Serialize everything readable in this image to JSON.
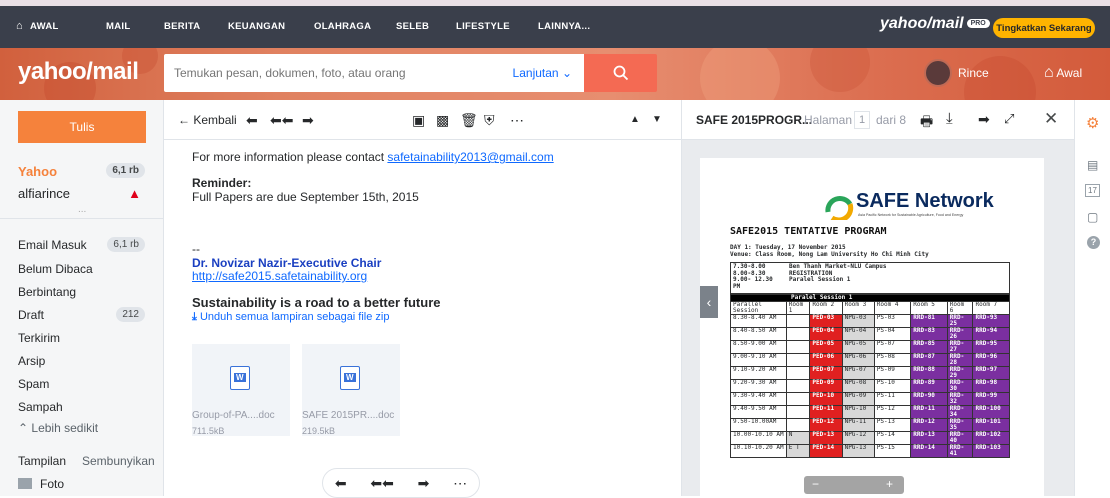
{
  "topnav": {
    "items": [
      "AWAL",
      "MAIL",
      "BERITA",
      "KEUANGAN",
      "OLAHRAGA",
      "SELEB",
      "LIFESTYLE",
      "LAINNYA..."
    ],
    "brand": "yahoo/mail",
    "pro": "PRO",
    "upgrade": "Tingkatkan Sekarang"
  },
  "header": {
    "logo": "yahoo/mail",
    "search_placeholder": "Temukan pesan, dokumen, foto, atau orang",
    "advanced": "Lanjutan",
    "user": "Rince",
    "home": "Awal"
  },
  "sidebar": {
    "compose": "Tulis",
    "account1": "Yahoo",
    "account1_count": "6,1 rb",
    "account2": "alfiarince",
    "more_dots": "...",
    "folders": [
      {
        "label": "Email Masuk",
        "count": "6,1 rb"
      },
      {
        "label": "Belum Dibaca",
        "count": ""
      },
      {
        "label": "Berbintang",
        "count": ""
      },
      {
        "label": "Draft",
        "count": "212"
      },
      {
        "label": "Terkirim",
        "count": ""
      },
      {
        "label": "Arsip",
        "count": ""
      },
      {
        "label": "Spam",
        "count": ""
      },
      {
        "label": "Sampah",
        "count": ""
      }
    ],
    "less": "Lebih sedikit",
    "views": "Tampilan",
    "hide": "Sembunyikan",
    "photos": "Foto"
  },
  "reader": {
    "back": "Kembali",
    "line1": "For more information please contact ",
    "email_link": "safetainability2013@gmail.com",
    "reminder_title": "Reminder:",
    "reminder_text": "Full Papers are due September 15th, 2015",
    "sig_dash": "--",
    "sig_name": "Dr. Novizar Nazir-Executive Chair",
    "sig_url": "http://safe2015.safetainability.org",
    "tagline": "Sustainability is a road to a better future",
    "download_zip": "Unduh semua lampiran sebagai file zip",
    "attachments": [
      {
        "name": "Group-of-PA....doc",
        "size": "711.5kB"
      },
      {
        "name": "SAFE 2015PR....doc",
        "size": "219.5kB"
      }
    ]
  },
  "pdf": {
    "title": "SAFE 2015PROGR...",
    "page_label": "Halaman",
    "page_num": "1",
    "of": "dari 8",
    "logo": "SAFE Network",
    "logo_sub": "Asia Pacific Network for Sustainable Agriculture, Food and Energy",
    "doc_title": "SAFE2015 TENTATIVE PROGRAM",
    "day": "DAY 1: Tuesday, 17 November 2015",
    "venue": "Venue: Class Room, Nong Lam University Ho Chi Minh City",
    "intro_times": "7.30-8.00\n8.00-8.30\n9.00- 12.30\nPM",
    "intro_events": "Ben Thanh Market-NLU Campus\nREGISTRATION\nParalel Session 1",
    "section": "Paralel Session 1",
    "headers": [
      "Parallel Session",
      "Room 1",
      "Room 2",
      "Room 3",
      "Room 4",
      "Room 5",
      "Room 6",
      "Room 7"
    ],
    "rows": [
      [
        "8.30-8.40 AM",
        "",
        "PED-03",
        "NPG-03",
        "PS-03",
        "RRD-81",
        "RRD-25",
        "RRD-93"
      ],
      [
        "8.40-8.50 AM",
        "",
        "PED-04",
        "NPG-04",
        "PS-04",
        "RRD-83",
        "RRD-26",
        "RRD-94"
      ],
      [
        "8.50-9.00 AM",
        "",
        "PED-05",
        "NPG-05",
        "PS-07",
        "RRD-85",
        "RRD-27",
        "RRD-95"
      ],
      [
        "9.00-9.10 AM",
        "",
        "PED-06",
        "NPG-06",
        "PS-08",
        "RRD-87",
        "RRD-28",
        "RRD-96"
      ],
      [
        "9.10-9.20 AM",
        "",
        "PED-07",
        "NPG-07",
        "PS-09",
        "RRD-88",
        "RRD-29",
        "RRD-97"
      ],
      [
        "9.20-9.30 AM",
        "",
        "PED-09",
        "NPG-08",
        "PS-10",
        "RRD-89",
        "RRD-30",
        "RRD-98"
      ],
      [
        "9.30-9.40 AM",
        "",
        "PED-10",
        "NPG-09",
        "PS-11",
        "RRD-90",
        "RRD-32",
        "RRD-99"
      ],
      [
        "9.40-9.50 AM",
        "",
        "PED-11",
        "NPG-10",
        "PS-12",
        "RRD-11",
        "RRD-34",
        "RRD-100"
      ],
      [
        "9.50-10.00AM",
        "",
        "PED-12",
        "NPG-11",
        "PS-13",
        "RRD-12",
        "RRD-35",
        "RRD-101"
      ],
      [
        "10.00-10.10 AM",
        "N",
        "PED-13",
        "NPG-12",
        "PS-14",
        "RRD-13",
        "RRD-40",
        "RRD-102"
      ],
      [
        "10.10-10.20 AM",
        "E T",
        "PED-14",
        "NPG-13",
        "PS-15",
        "RRD-14",
        "RRD-41",
        "RRD-103"
      ]
    ]
  }
}
